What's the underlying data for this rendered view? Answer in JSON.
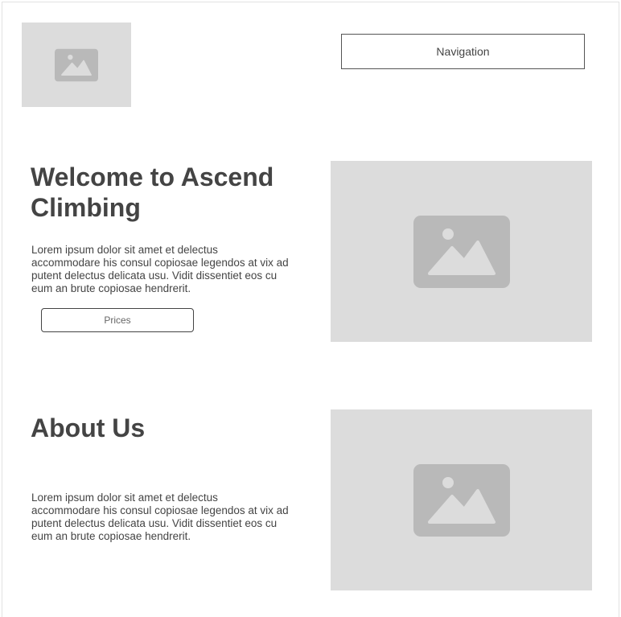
{
  "header": {
    "logo_icon": "image-placeholder-icon",
    "navigation_label": "Navigation"
  },
  "hero": {
    "title": "Welcome to Ascend Climbing",
    "body": "Lorem ipsum dolor sit amet et delectus accommodare his consul copiosae legendos at vix ad putent delectus delicata usu. Vidit dissentiet eos cu eum an brute copiosae hendrerit.",
    "prices_label": "Prices",
    "image_icon": "image-placeholder-icon"
  },
  "about": {
    "title": "About Us",
    "body": "Lorem ipsum dolor sit amet et delectus accommodare his consul copiosae legendos at vix ad putent delectus delicata usu. Vidit dissentiet eos cu eum an brute copiosae hendrerit.",
    "image_icon": "image-placeholder-icon"
  },
  "colors": {
    "placeholder_bg": "#dcdcdc",
    "placeholder_icon": "#b9b9b9",
    "text": "#444444",
    "background": "#ffffff"
  }
}
